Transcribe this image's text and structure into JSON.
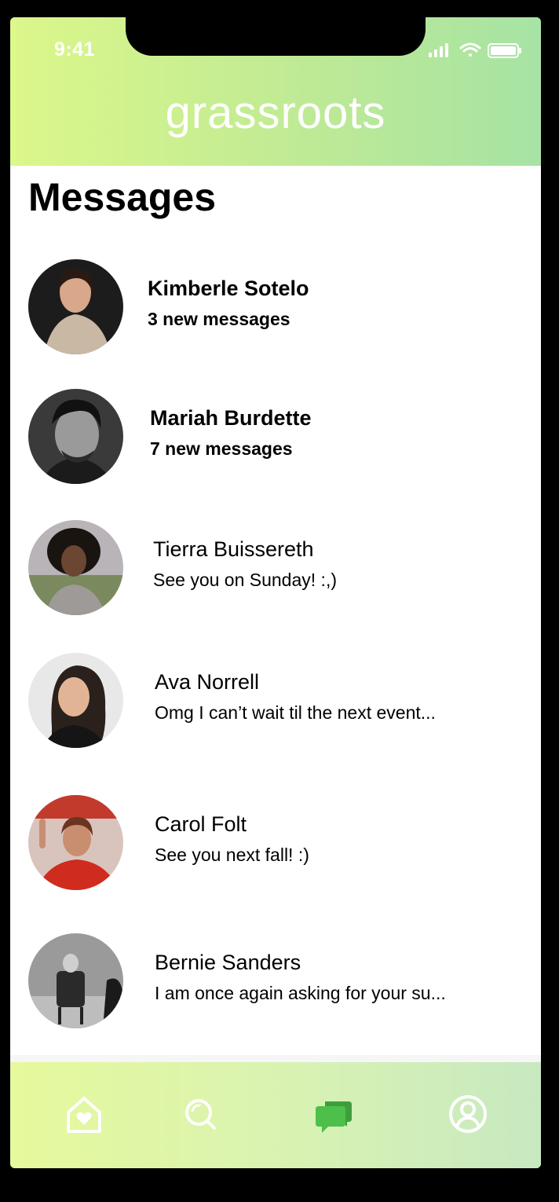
{
  "status": {
    "time": "9:41",
    "icons": [
      "signal-icon",
      "wifi-icon",
      "battery-icon"
    ]
  },
  "header": {
    "brand": "grassroots"
  },
  "page": {
    "title": "Messages"
  },
  "messages": [
    {
      "name": "Kimberle Sotelo",
      "preview": "3 new messages",
      "unread": true,
      "avatar": "avatar-photo"
    },
    {
      "name": "Mariah Burdette",
      "preview": "7 new messages",
      "unread": true,
      "avatar": "avatar-photo"
    },
    {
      "name": "Tierra Buissereth",
      "preview": "See you on Sunday! :,)",
      "unread": false,
      "avatar": "avatar-photo"
    },
    {
      "name": "Ava Norrell",
      "preview": "Omg I can’t wait til the next event...",
      "unread": false,
      "avatar": "avatar-photo"
    },
    {
      "name": "Carol Folt",
      "preview": "See you next fall! :)",
      "unread": false,
      "avatar": "avatar-photo"
    },
    {
      "name": "Bernie Sanders",
      "preview": "I am once again asking for your su...",
      "unread": false,
      "avatar": "avatar-photo"
    }
  ],
  "nav": {
    "items": [
      {
        "icon": "home-heart-icon",
        "active": false
      },
      {
        "icon": "search-icon",
        "active": false
      },
      {
        "icon": "chat-bubbles-icon",
        "active": true
      },
      {
        "icon": "profile-icon",
        "active": false
      }
    ]
  },
  "colors": {
    "header_gradient": [
      "#dcf78a",
      "#a6e3a4"
    ],
    "nav_gradient": [
      "#e6f99c",
      "#c7e9c1"
    ],
    "active_nav": "#4cc04a",
    "inactive_nav": "#ffffff"
  }
}
